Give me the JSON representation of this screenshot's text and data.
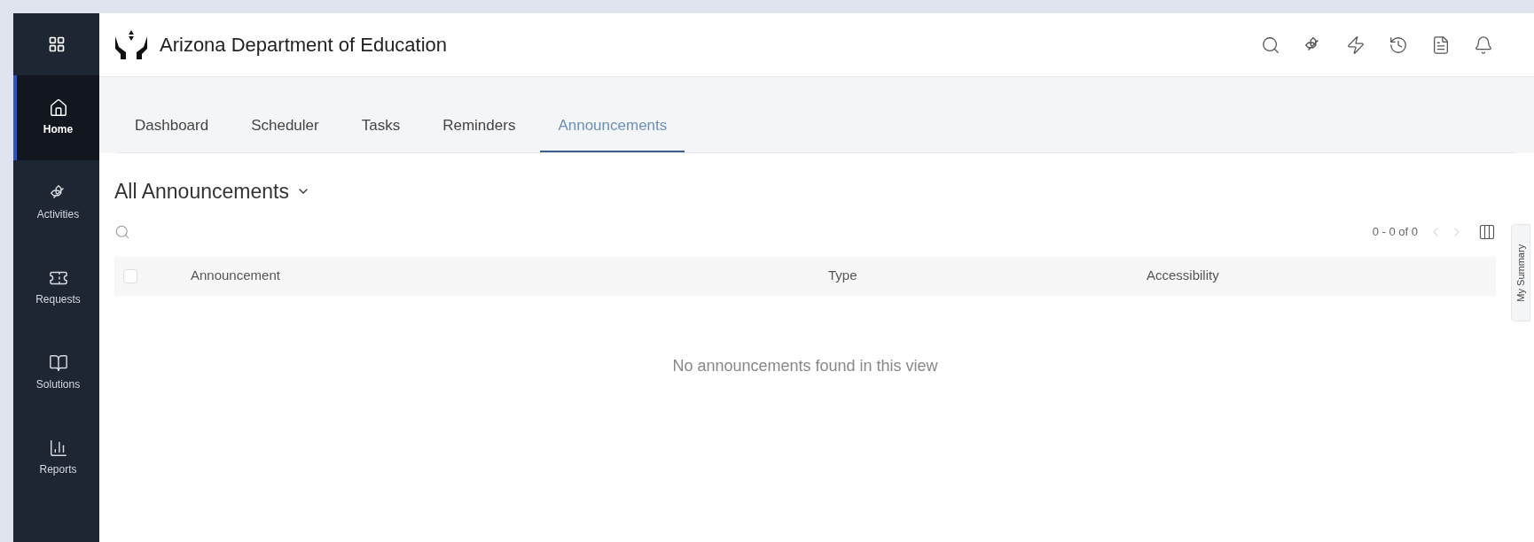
{
  "header": {
    "title": "Arizona Department of Education"
  },
  "sidebar": {
    "items": [
      {
        "label": "Home",
        "selected": true
      },
      {
        "label": "Activities",
        "selected": false
      },
      {
        "label": "Requests",
        "selected": false
      },
      {
        "label": "Solutions",
        "selected": false
      },
      {
        "label": "Reports",
        "selected": false
      }
    ]
  },
  "tabs": [
    {
      "label": "Dashboard",
      "selected": false
    },
    {
      "label": "Scheduler",
      "selected": false
    },
    {
      "label": "Tasks",
      "selected": false
    },
    {
      "label": "Reminders",
      "selected": false
    },
    {
      "label": "Announcements",
      "selected": true
    }
  ],
  "view": {
    "title": "All Announcements",
    "pager": "0 - 0 of 0"
  },
  "table": {
    "select_all": {
      "checked": false
    },
    "columns": [
      "Announcement",
      "Type",
      "Accessibility"
    ],
    "empty_message": "No announcements found in this view"
  },
  "side_panel": {
    "label": "My Summary"
  }
}
